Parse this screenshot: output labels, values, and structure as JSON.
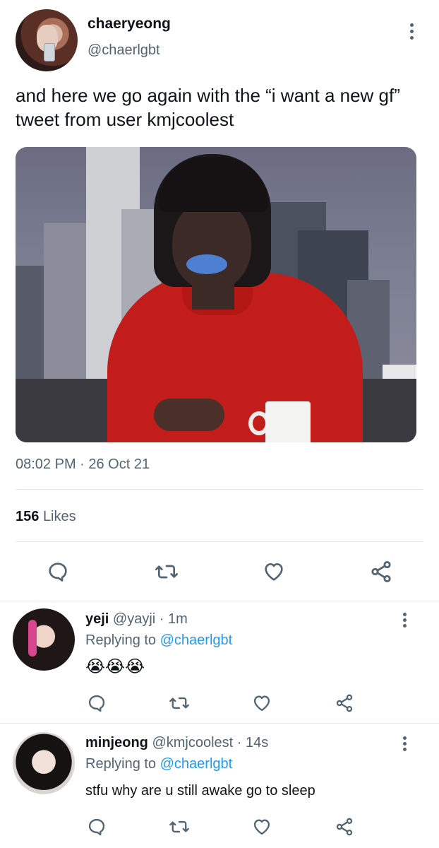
{
  "author": {
    "display_name": "chaeryeong",
    "handle": "@chaerlgbt"
  },
  "tweet": {
    "text": "and here we go again with the “i want a new gf” tweet from user kmjcoolest",
    "timestamp": "08:02 PM · 26 Oct 21",
    "likes_count": "156",
    "likes_label": "Likes"
  },
  "actions": [
    "reply-icon",
    "retweet-icon",
    "like-icon",
    "share-icon"
  ],
  "replies": [
    {
      "name": "yeji",
      "handle": "@yayji",
      "time": "· 1m",
      "replying_label": "Replying to",
      "replying_to": "@chaerlgbt",
      "text": "😭😭😭"
    },
    {
      "name": "minjeong",
      "handle": "@kmjcoolest",
      "time": "· 14s",
      "replying_label": "Replying to",
      "replying_to": "@chaerlgbt",
      "text": "stfu why are u still awake go to sleep"
    }
  ],
  "colors": {
    "text": "#0f1419",
    "secondary": "#536471",
    "link": "#1d9bf0",
    "divider": "#e6e9ec"
  }
}
